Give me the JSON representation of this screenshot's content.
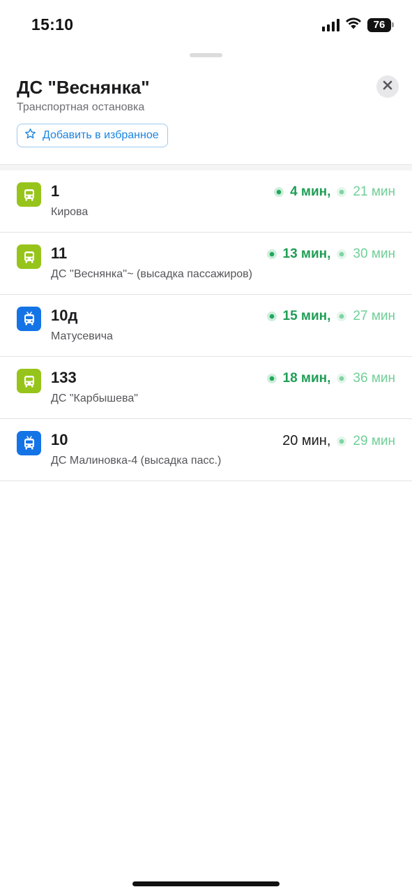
{
  "status_bar": {
    "time": "15:10",
    "battery": "76",
    "icons": [
      "signal-icon",
      "wifi-icon",
      "battery-icon"
    ]
  },
  "stop": {
    "title": "ДС \"Веснянка\"",
    "subtitle": "Транспортная остановка",
    "favorite_label": "Добавить в избранное",
    "close_icon": "close-icon",
    "favorite_icon": "star-icon"
  },
  "colors": {
    "bus": "#97c41b",
    "trolleybus": "#1474e6",
    "arrival_primary": "#1f9e55",
    "arrival_secondary": "#6fcf97",
    "accent_link": "#1a84e0"
  },
  "routes": [
    {
      "number": "1",
      "type": "bus",
      "icon": "bus-icon",
      "destination": "Кирова",
      "first": "4 мин,",
      "first_live": true,
      "second": "21 мин"
    },
    {
      "number": "11",
      "type": "bus",
      "icon": "bus-icon",
      "destination": "ДС ''Веснянка''~ (высадка пассажиров)",
      "first": "13 мин,",
      "first_live": true,
      "second": "30 мин"
    },
    {
      "number": "10д",
      "type": "trolleybus",
      "icon": "trolleybus-icon",
      "destination": "Матусевича",
      "first": "15 мин,",
      "first_live": true,
      "second": "27 мин"
    },
    {
      "number": "133",
      "type": "bus",
      "icon": "bus-icon",
      "destination": "ДС \"Карбышева\"",
      "first": "18 мин,",
      "first_live": true,
      "second": "36 мин"
    },
    {
      "number": "10",
      "type": "trolleybus",
      "icon": "trolleybus-icon",
      "destination": "ДС Малиновка-4 (высадка пасс.)",
      "first": "20 мин,",
      "first_live": false,
      "second": "29 мин"
    }
  ]
}
